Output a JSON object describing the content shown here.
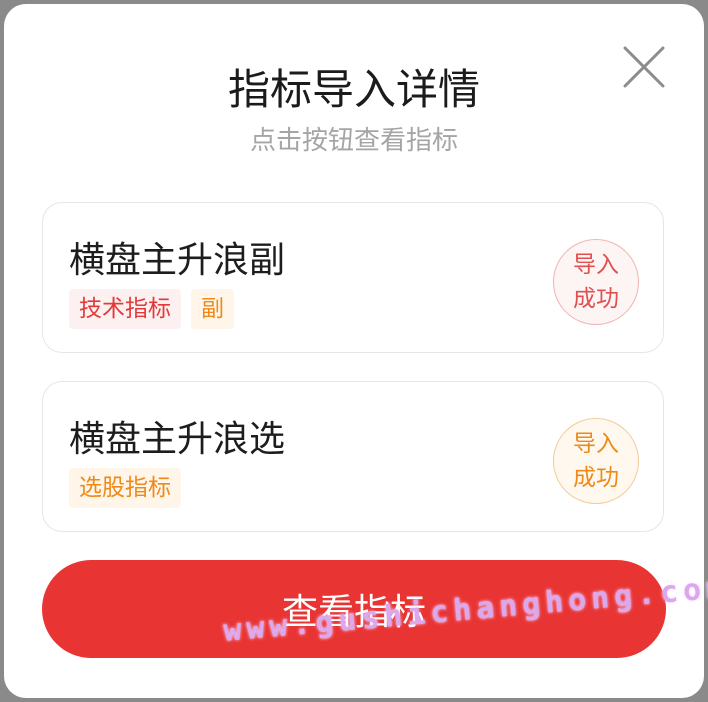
{
  "dialog": {
    "title": "指标导入详情",
    "subtitle": "点击按钮查看指标",
    "close_icon": "close-icon",
    "items": [
      {
        "name": "横盘主升浪副",
        "tags": [
          {
            "label": "技术指标",
            "color": "#e23a3a"
          },
          {
            "label": "副",
            "color": "#ee8a1a"
          }
        ],
        "status_line1": "导入",
        "status_line2": "成功",
        "status_color": "#e05050"
      },
      {
        "name": "横盘主升浪选",
        "tags": [
          {
            "label": "选股指标",
            "color": "#ee8a1a"
          }
        ],
        "status_line1": "导入",
        "status_line2": "成功",
        "status_color": "#ee8a1a"
      }
    ],
    "primary_button_label": "查看指标",
    "primary_color": "#e93434"
  },
  "watermark": "www.gushichanghong.com"
}
